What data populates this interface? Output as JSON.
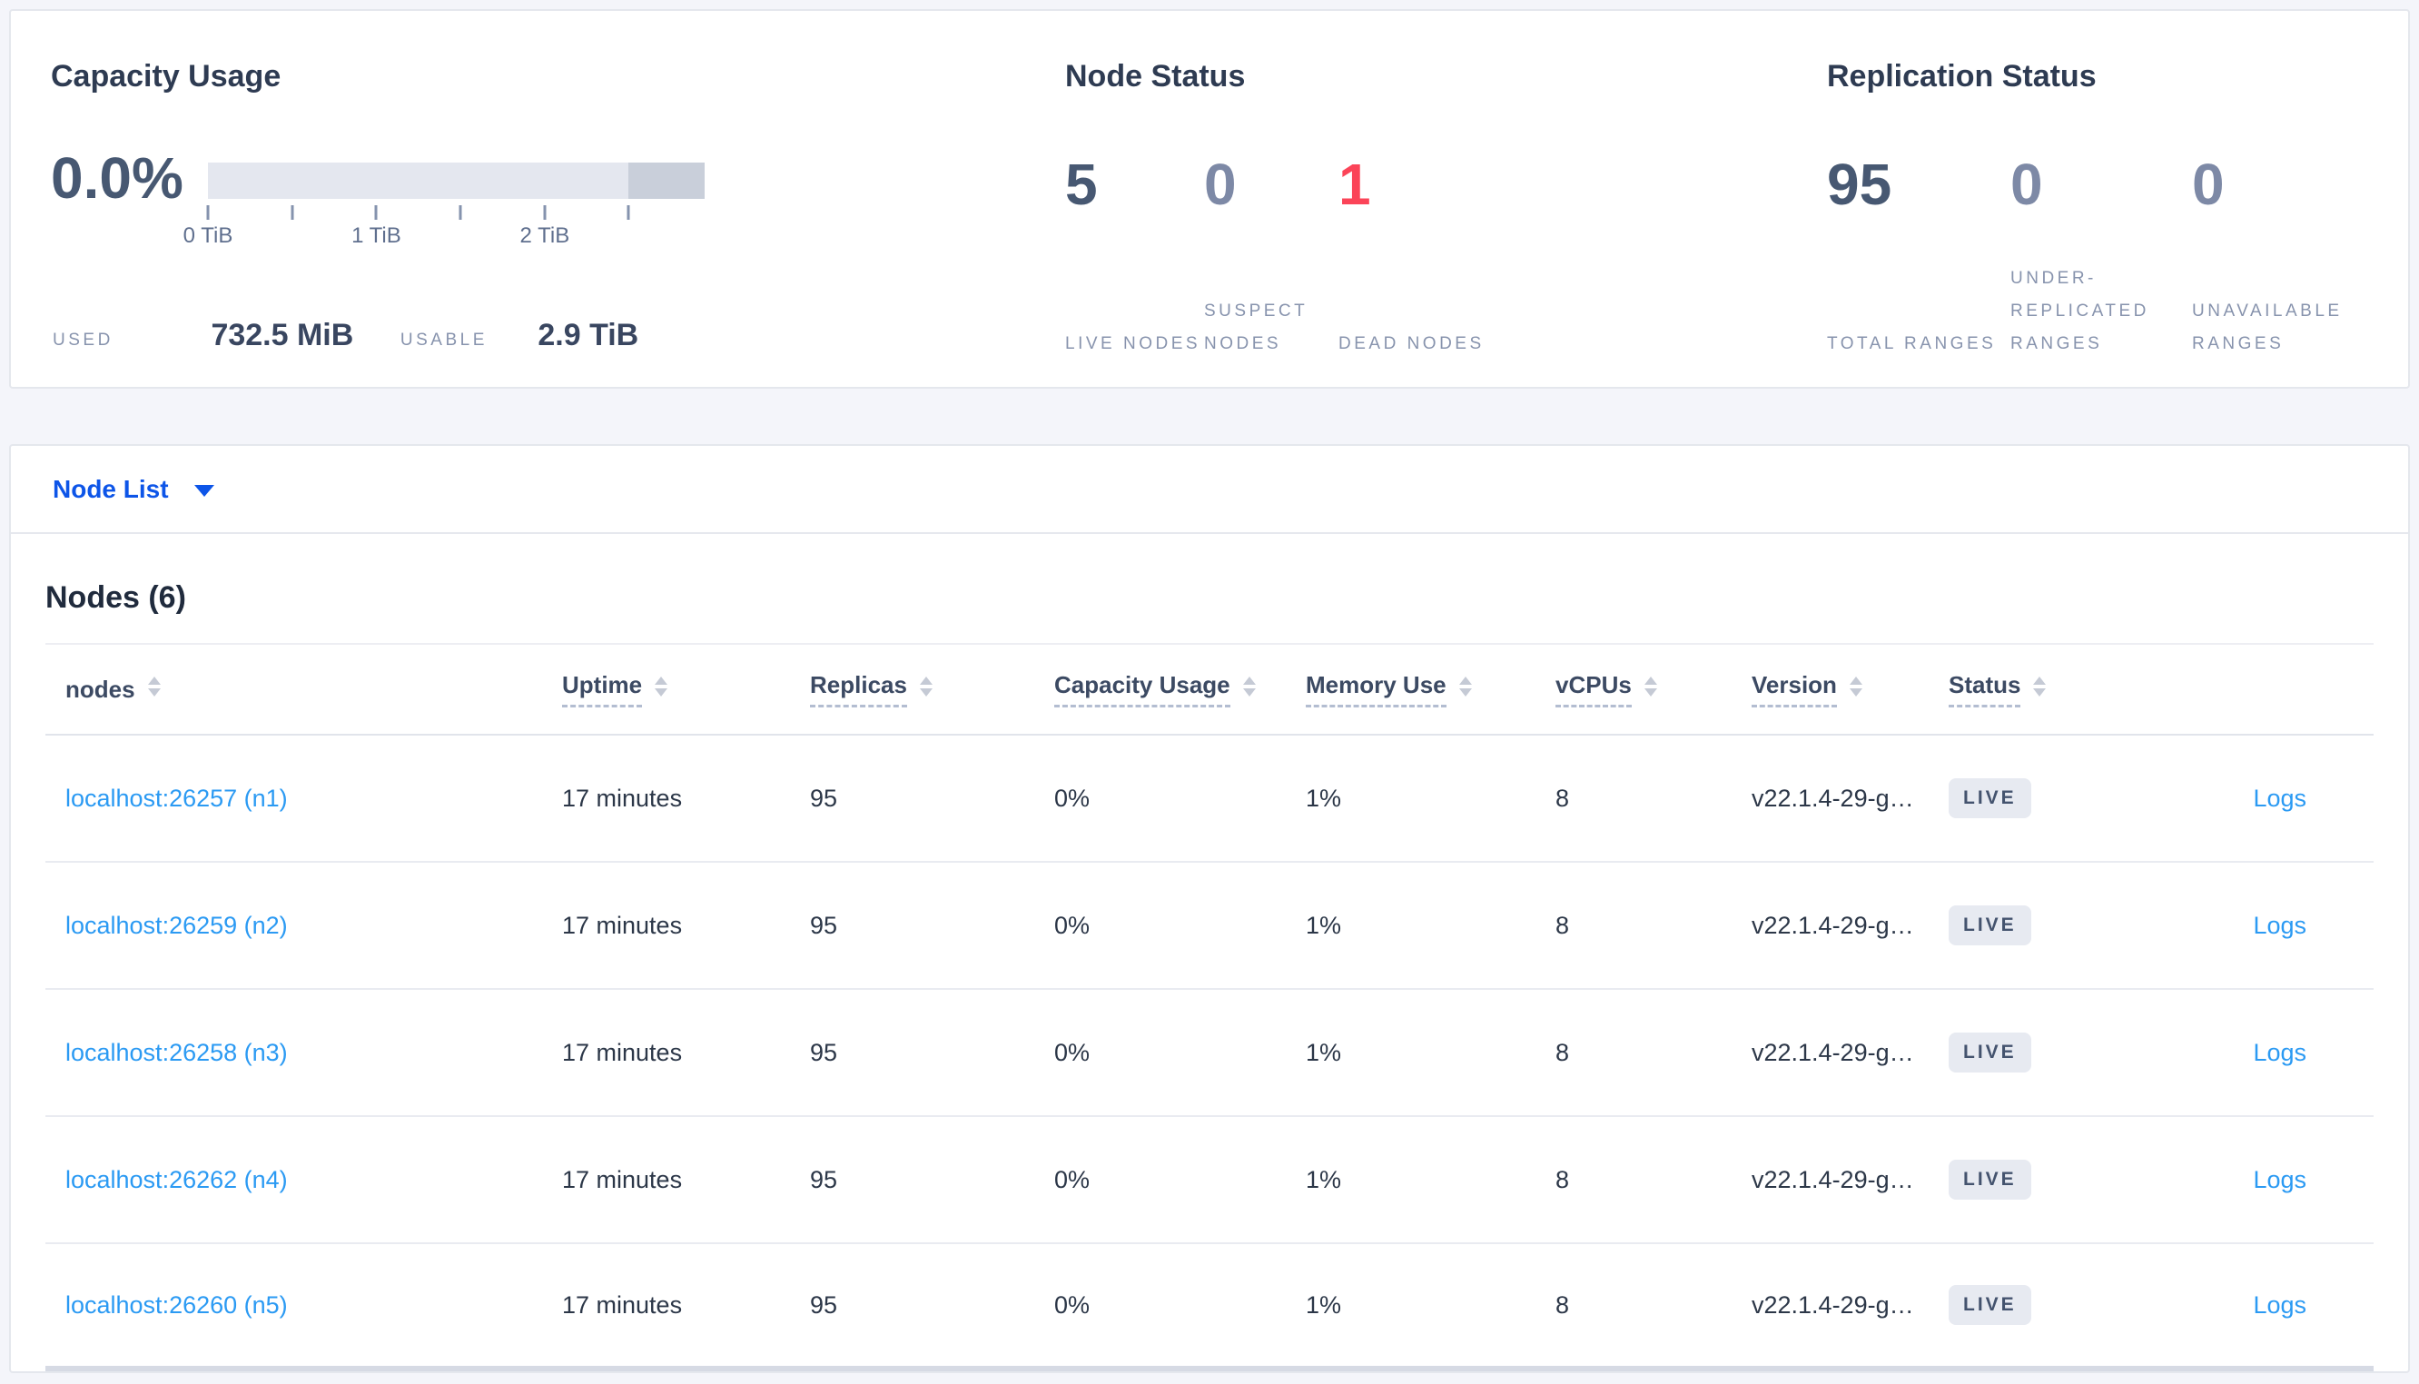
{
  "summary": {
    "capacity": {
      "title": "Capacity Usage",
      "percent": "0.0%",
      "used_label": "USED",
      "used_value": "732.5 MiB",
      "usable_label": "USABLE",
      "usable_value": "2.9 TiB",
      "bar": {
        "used_fraction": 0.0,
        "usable_fraction": 0.847,
        "used_fill_style": "width:0%",
        "dark_segment_style": "width:15.3%"
      },
      "ticks": [
        {
          "label": "0 TiB"
        },
        {
          "label": "1 TiB"
        },
        {
          "label": "2 TiB"
        }
      ]
    },
    "node_status": {
      "title": "Node Status",
      "stats": [
        {
          "value": "5",
          "label": "LIVE NODES"
        },
        {
          "value": "0",
          "label": "SUSPECT NODES"
        },
        {
          "value": "1",
          "label": "DEAD NODES"
        }
      ]
    },
    "replication": {
      "title": "Replication Status",
      "stats": [
        {
          "value": "95",
          "label": "TOTAL RANGES"
        },
        {
          "value": "0",
          "label": "UNDER-REPLICATED RANGES"
        },
        {
          "value": "0",
          "label": "UNAVAILABLE RANGES"
        }
      ]
    }
  },
  "nodelist": {
    "label": "Node List"
  },
  "table": {
    "title": "Nodes (6)",
    "columns": [
      {
        "label": "nodes"
      },
      {
        "label": "Uptime"
      },
      {
        "label": "Replicas"
      },
      {
        "label": "Capacity Usage"
      },
      {
        "label": "Memory Use"
      },
      {
        "label": "vCPUs"
      },
      {
        "label": "Version"
      },
      {
        "label": "Status"
      }
    ],
    "rows": [
      {
        "node": "localhost:26257 (n1)",
        "uptime": "17 minutes",
        "replicas": "95",
        "capacity": "0%",
        "memory": "1%",
        "vcpus": "8",
        "version": "v22.1.4-29-g…",
        "status": "LIVE",
        "logs": "Logs"
      },
      {
        "node": "localhost:26259 (n2)",
        "uptime": "17 minutes",
        "replicas": "95",
        "capacity": "0%",
        "memory": "1%",
        "vcpus": "8",
        "version": "v22.1.4-29-g…",
        "status": "LIVE",
        "logs": "Logs"
      },
      {
        "node": "localhost:26258 (n3)",
        "uptime": "17 minutes",
        "replicas": "95",
        "capacity": "0%",
        "memory": "1%",
        "vcpus": "8",
        "version": "v22.1.4-29-g…",
        "status": "LIVE",
        "logs": "Logs"
      },
      {
        "node": "localhost:26262 (n4)",
        "uptime": "17 minutes",
        "replicas": "95",
        "capacity": "0%",
        "memory": "1%",
        "vcpus": "8",
        "version": "v22.1.4-29-g…",
        "status": "LIVE",
        "logs": "Logs"
      },
      {
        "node": "localhost:26260 (n5)",
        "uptime": "17 minutes",
        "replicas": "95",
        "capacity": "0%",
        "memory": "1%",
        "vcpus": "8",
        "version": "v22.1.4-29-g…",
        "status": "LIVE",
        "logs": "Logs"
      }
    ]
  },
  "colors": {
    "accent_blue": "#0d55e8",
    "link_blue": "#2b9af3",
    "dead_red": "#fb4458",
    "stat_slate": "#475872",
    "muted_slate": "#7d89a6"
  }
}
